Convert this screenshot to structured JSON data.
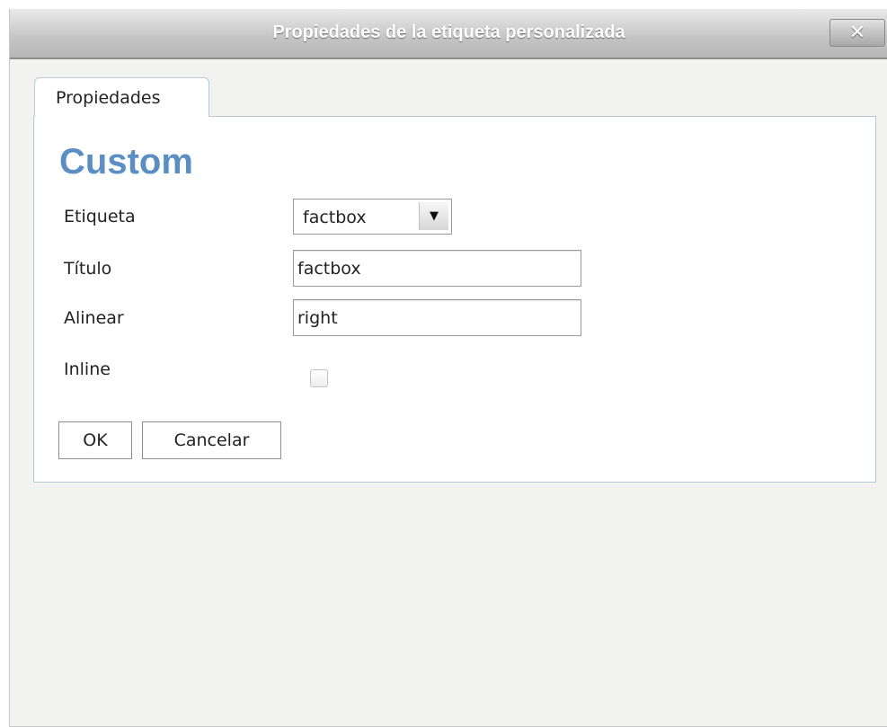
{
  "dialog": {
    "title": "Propiedades de la etiqueta personalizada",
    "close_icon": "close-icon",
    "close_glyph": "✕"
  },
  "tabs": [
    {
      "label": "Propiedades",
      "active": true
    }
  ],
  "form": {
    "heading": "Custom",
    "etiqueta": {
      "label": "Etiqueta",
      "value": "factbox",
      "arrow_glyph": "▼"
    },
    "titulo": {
      "label": "Título",
      "value": "factbox"
    },
    "alinear": {
      "label": "Alinear",
      "value": "right"
    },
    "inline": {
      "label": "Inline",
      "checked": false
    }
  },
  "buttons": {
    "ok": "OK",
    "cancel": "Cancelar"
  },
  "colors": {
    "heading": "#5b8fc4",
    "panel_border": "#b9c6d3",
    "dialog_bg": "#f2f2f0"
  }
}
